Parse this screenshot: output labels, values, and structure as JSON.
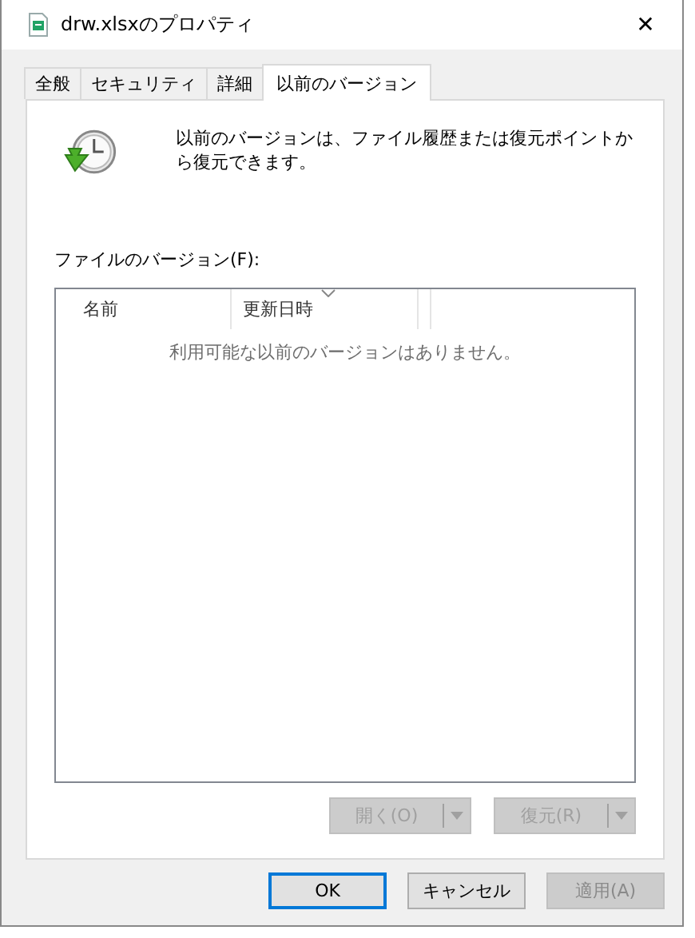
{
  "window": {
    "title": "drw.xlsxのプロパティ",
    "close": "✕"
  },
  "tabs": [
    {
      "label": "全般",
      "selected": false
    },
    {
      "label": "セキュリティ",
      "selected": false
    },
    {
      "label": "詳細",
      "selected": false
    },
    {
      "label": "以前のバージョン",
      "selected": true
    }
  ],
  "intro": "以前のバージョンは、ファイル履歴または復元ポイントから復元できます。",
  "list_label": "ファイルのバージョン(F):",
  "list": {
    "columns": [
      {
        "label": "名前",
        "sorted": false
      },
      {
        "label": "更新日時",
        "sorted": true
      }
    ],
    "empty_message": "利用可能な以前のバージョンはありません。"
  },
  "split_buttons": [
    {
      "label": "開く(O)",
      "disabled": true
    },
    {
      "label": "復元(R)",
      "disabled": true
    }
  ],
  "buttons": [
    {
      "label": "OK",
      "default": true,
      "disabled": false
    },
    {
      "label": "キャンセル",
      "default": false,
      "disabled": false
    },
    {
      "label": "適用(A)",
      "default": false,
      "disabled": true
    }
  ]
}
